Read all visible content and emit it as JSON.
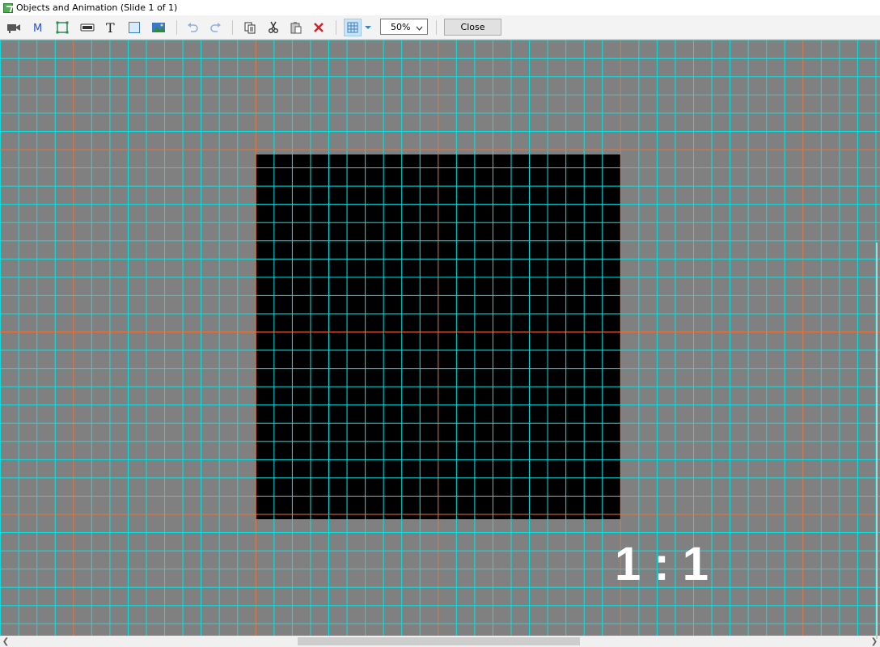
{
  "window": {
    "title": "Objects and Animation (Slide 1 of 1)"
  },
  "toolbar": {
    "zoom": {
      "value": "50%"
    },
    "close_label": "Close",
    "icons": [
      "camera-icon",
      "mask-icon",
      "rectangle-frame-icon",
      "button-icon",
      "text-icon",
      "image-frame-icon",
      "picture-icon",
      "undo-icon",
      "redo-icon",
      "copy-icon",
      "cut-icon",
      "paste-icon",
      "delete-icon",
      "grid-icon",
      "grid-dropdown-icon"
    ]
  },
  "canvas": {
    "aspect_ratio_label": "1 : 1",
    "colors": {
      "background": "#808080",
      "slide": "#000000",
      "grid_minor": "#00e5e5",
      "grid_major": "#e8743b"
    }
  }
}
